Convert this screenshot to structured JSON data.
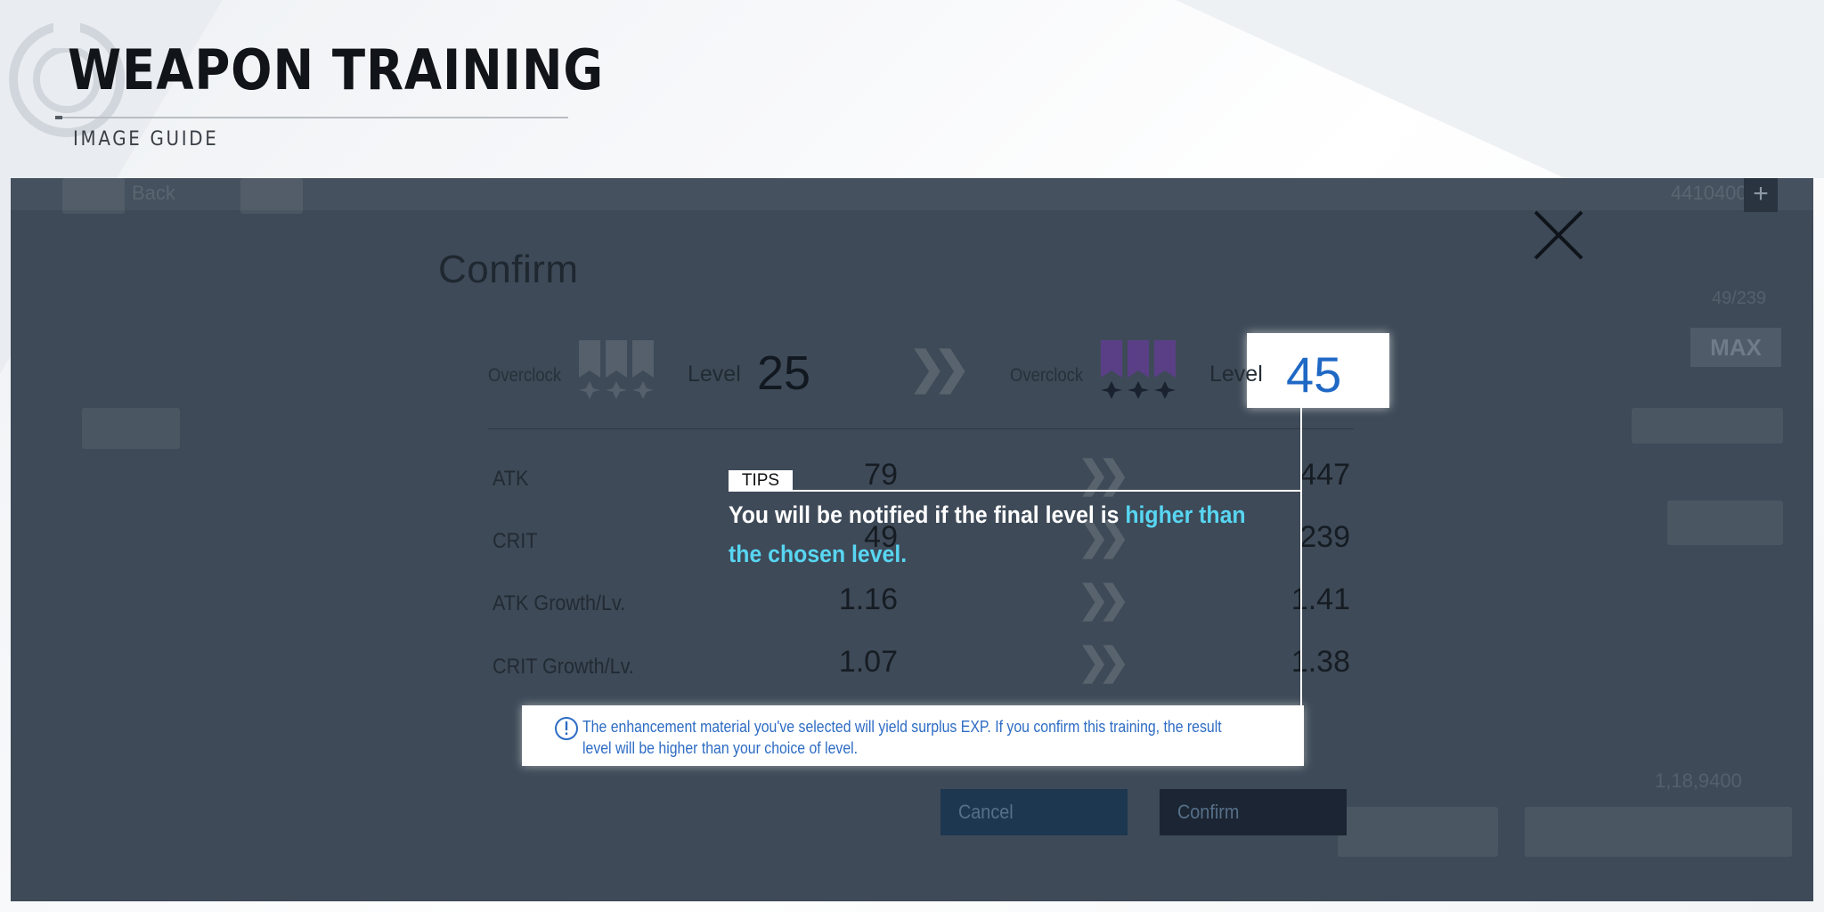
{
  "header": {
    "title": "WEAPON TRAINING",
    "subtitle": "IMAGE GUIDE"
  },
  "game": {
    "background_text": {
      "back": "Back",
      "currency": "4410400",
      "level_fraction": "49/239",
      "bottom_currency": "1,18,9400"
    },
    "max_button": "MAX",
    "dialog": {
      "title": "Confirm",
      "before": {
        "overclock_label": "Overclock",
        "level_label": "Level",
        "level_value": "25"
      },
      "after": {
        "overclock_label": "Overclock",
        "level_label": "Level",
        "level_value": "45"
      },
      "stats": [
        {
          "name": "ATK",
          "before": "79",
          "after": "447"
        },
        {
          "name": "CRIT",
          "before": "49",
          "after": "239"
        },
        {
          "name": "ATK Growth/Lv.",
          "before": "1.16",
          "after": "1.41"
        },
        {
          "name": "CRIT Growth/Lv.",
          "before": "1.07",
          "after": "1.38"
        }
      ],
      "notice": "The enhancement material you've selected will yield surplus EXP. If you confirm this training, the result level will be higher than your choice of level.",
      "cancel_label": "Cancel",
      "confirm_label": "Confirm"
    }
  },
  "tips": {
    "badge": "TIPS",
    "text_plain": "You will be notified if the final level is ",
    "text_highlight": "higher than the chosen level."
  },
  "colors": {
    "highlight_blue": "#1f68c4",
    "tips_cyan": "#58d6f2",
    "notice_blue": "#2d6cc4",
    "overlay": "#3e4a58"
  }
}
